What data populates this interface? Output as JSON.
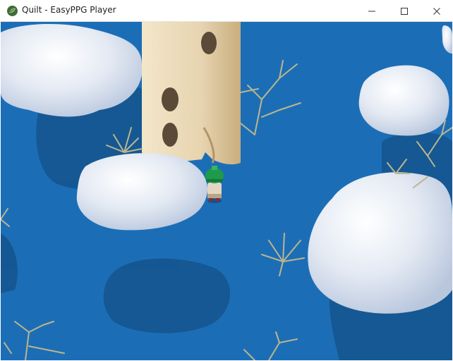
{
  "window": {
    "title": "Quilt - EasyPPG Player",
    "icon": "quilt-leaf-icon",
    "controls": [
      "minimize-icon",
      "maximize-icon",
      "close-icon"
    ]
  },
  "scene": {
    "water_color": "#1b6eb6",
    "shadow_color": "#154f87",
    "cloud_color": "#e8eef7",
    "tower_color": "#e7d4b0",
    "coral_color": "#bdb58d",
    "player_hat_color": "#1e9a4a"
  }
}
